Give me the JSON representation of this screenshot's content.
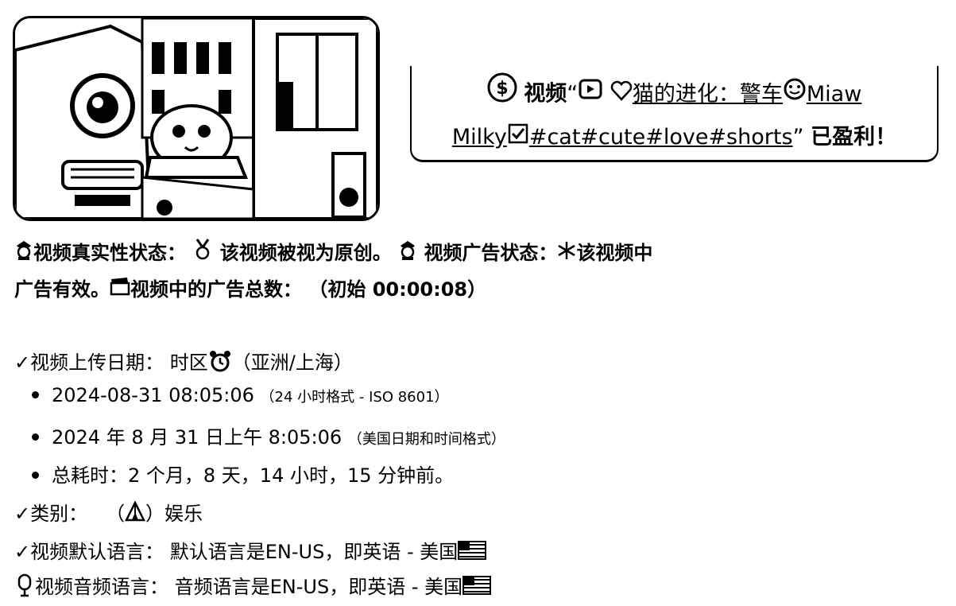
{
  "thumbnail": {
    "alt": "cat police car thumbnail"
  },
  "monetization": {
    "prefix": "视频",
    "open_quote": "“",
    "title_part1": "猫的进化：警车",
    "title_part2": "Miaw",
    "title_part3": "Milky",
    "hashtags": "#cat#cute#love#shorts",
    "close_quote": "”",
    "suffix": "已盈利！"
  },
  "status": {
    "authenticity_label": "视频真实性状态：",
    "authenticity_value": "该视频被视为原创。",
    "ad_label": "视频广告状态：",
    "ad_value_1": "该视频中",
    "ad_value_2": "广告有效。",
    "ad_count_label": "视频中的广告总数：",
    "ad_count_value": "（初始 00:00:08）"
  },
  "upload": {
    "label": "视频上传日期：",
    "tz_prefix": "时区",
    "tz_value": "（亚洲/上海）",
    "iso_value": "2024-08-31 08:05:06",
    "iso_note": "（24 小时格式 - ISO 8601）",
    "us_value": "2024 年 8 月 31 日上午 8:05:06",
    "us_note": "（美国日期和时间格式）",
    "elapsed": "总耗时：2 个月，8 天，14 小时，15 分钟前。"
  },
  "category": {
    "label": "类别：",
    "open": "（",
    "close": "）",
    "value": "娱乐"
  },
  "default_lang": {
    "label": "视频默认语言：",
    "value": "默认语言是EN-US，即英语 - 美国"
  },
  "audio_lang": {
    "label": "视频音频语言：",
    "value": "音频语言是EN-US，即英语 - 美国"
  },
  "icons": [
    "dollar-icon",
    "play-icon",
    "heart-icon",
    "smile-icon",
    "checkbox-icon",
    "cop-icon",
    "medal-icon",
    "snowflake-icon",
    "clapper-icon",
    "check-icon",
    "alarm-icon",
    "circus-tent-icon",
    "us-flag-icon",
    "microphone-icon"
  ]
}
